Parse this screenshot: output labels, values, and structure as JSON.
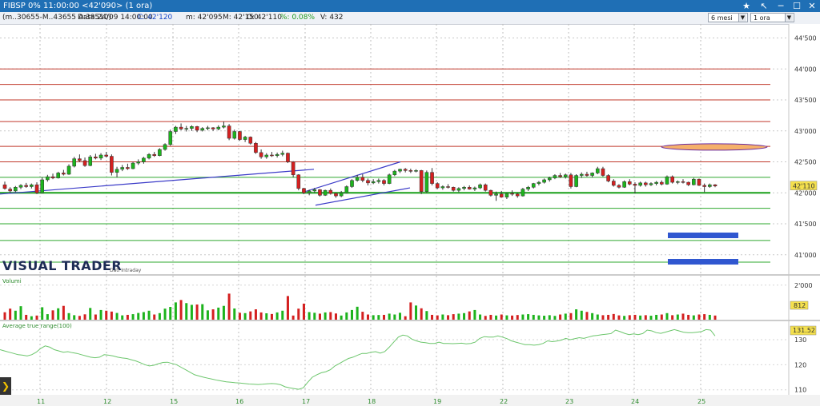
{
  "window": {
    "title": "FIBSP 0% 11:00:00  <42'090>  (1 ora)"
  },
  "infobar": {
    "ref": "(m..30655-M..43655 A:38510)",
    "date": "Data:24/09 14:00:00",
    "close": "C: 42'120",
    "min": "m: 42'095",
    "max": "M: 42'150",
    "open": "O: 42'110",
    "pct": "%: 0.08%",
    "vol": "V: 432",
    "period_select": "6 mesi",
    "interval_select": "1 ora"
  },
  "colors": {
    "up": "#1db31d",
    "down": "#d42020",
    "level_red": "#c0392b",
    "level_green": "#2ea82e",
    "trend": "#3b3bc8",
    "atr": "#6cc66c",
    "marker": "#3057d0",
    "ellipse_fill": "#f5b06a",
    "ellipse_stroke": "#6a2aa0"
  },
  "watermark": {
    "brand": "VISUAL TRADER",
    "sub": "Dati Intraday"
  },
  "chart_data": [
    {
      "type": "candlestick",
      "title": "FIBSP",
      "ylim": [
        40700,
        44700
      ],
      "y_ticks": [
        "44'500",
        "44'000",
        "43'500",
        "43'000",
        "42'500",
        "42'000",
        "41'500",
        "41'000"
      ],
      "y_tick_values": [
        44500,
        44000,
        43500,
        43000,
        42500,
        42000,
        41500,
        41000
      ],
      "x_labels": [
        "11",
        "12",
        "15",
        "16",
        "17",
        "18",
        "19",
        "22",
        "23",
        "24",
        "25"
      ],
      "last_price_label": "42'110",
      "last_price": 42110,
      "red_levels": [
        44000,
        43750,
        43500,
        43150,
        42750,
        42500
      ],
      "green_levels": [
        42250,
        42000,
        41750,
        41500,
        41230,
        40880
      ],
      "candles": [
        [
          42130,
          42180,
          42050,
          42070
        ],
        [
          42060,
          42090,
          42000,
          42030
        ],
        [
          42030,
          42110,
          42010,
          42090
        ],
        [
          42090,
          42140,
          42060,
          42120
        ],
        [
          42120,
          42160,
          42080,
          42100
        ],
        [
          42100,
          42150,
          42070,
          42130
        ],
        [
          42130,
          42170,
          41980,
          42000
        ],
        [
          42000,
          42250,
          41990,
          42210
        ],
        [
          42210,
          42290,
          42180,
          42260
        ],
        [
          42260,
          42310,
          42220,
          42240
        ],
        [
          42240,
          42340,
          42230,
          42320
        ],
        [
          42320,
          42370,
          42280,
          42300
        ],
        [
          42300,
          42460,
          42290,
          42430
        ],
        [
          42430,
          42580,
          42410,
          42550
        ],
        [
          42550,
          42620,
          42500,
          42520
        ],
        [
          42520,
          42570,
          42420,
          42440
        ],
        [
          42440,
          42610,
          42430,
          42580
        ],
        [
          42580,
          42630,
          42540,
          42560
        ],
        [
          42560,
          42640,
          42530,
          42610
        ],
        [
          42610,
          42660,
          42570,
          42590
        ],
        [
          42590,
          42620,
          42280,
          42330
        ],
        [
          42330,
          42420,
          42250,
          42380
        ],
        [
          42380,
          42450,
          42350,
          42410
        ],
        [
          42410,
          42470,
          42370,
          42390
        ],
        [
          42390,
          42500,
          42380,
          42480
        ],
        [
          42480,
          42540,
          42450,
          42500
        ],
        [
          42500,
          42580,
          42470,
          42560
        ],
        [
          42560,
          42640,
          42540,
          42620
        ],
        [
          42620,
          42660,
          42580,
          42600
        ],
        [
          42600,
          42720,
          42590,
          42700
        ],
        [
          42700,
          42800,
          42680,
          42780
        ],
        [
          42780,
          43020,
          42760,
          42990
        ],
        [
          42990,
          43080,
          42950,
          43060
        ],
        [
          43060,
          43120,
          43010,
          43030
        ],
        [
          43030,
          43080,
          42990,
          43040
        ],
        [
          43040,
          43090,
          43000,
          43070
        ],
        [
          43070,
          43080,
          42980,
          43010
        ],
        [
          43010,
          43060,
          42990,
          43040
        ],
        [
          43040,
          43080,
          43010,
          43050
        ],
        [
          43050,
          43060,
          43000,
          43030
        ],
        [
          43030,
          43090,
          43010,
          43060
        ],
        [
          43060,
          43150,
          43040,
          43080
        ],
        [
          43080,
          43110,
          42850,
          42880
        ],
        [
          42880,
          43020,
          42860,
          42990
        ],
        [
          42990,
          43000,
          42840,
          42860
        ],
        [
          42860,
          42920,
          42820,
          42900
        ],
        [
          42900,
          42910,
          42780,
          42800
        ],
        [
          42800,
          42820,
          42630,
          42650
        ],
        [
          42650,
          42700,
          42550,
          42580
        ],
        [
          42580,
          42640,
          42550,
          42610
        ],
        [
          42610,
          42660,
          42580,
          42600
        ],
        [
          42600,
          42650,
          42570,
          42620
        ],
        [
          42620,
          42680,
          42590,
          42640
        ],
        [
          42640,
          42650,
          42480,
          42500
        ],
        [
          42500,
          42510,
          42250,
          42290
        ],
        [
          42290,
          42300,
          42040,
          42070
        ],
        [
          42070,
          42080,
          41980,
          42000
        ],
        [
          42000,
          42050,
          41960,
          42030
        ],
        [
          42030,
          42080,
          42000,
          42050
        ],
        [
          42050,
          42060,
          41940,
          41960
        ],
        [
          41960,
          42050,
          41950,
          42040
        ],
        [
          42040,
          42070,
          41970,
          41990
        ],
        [
          41990,
          42000,
          41920,
          41950
        ],
        [
          41950,
          42030,
          41930,
          42000
        ],
        [
          42000,
          42120,
          41990,
          42100
        ],
        [
          42100,
          42220,
          42080,
          42200
        ],
        [
          42200,
          42290,
          42180,
          42250
        ],
        [
          42250,
          42300,
          42170,
          42200
        ],
        [
          42200,
          42230,
          42120,
          42160
        ],
        [
          42160,
          42220,
          42140,
          42180
        ],
        [
          42180,
          42230,
          42150,
          42200
        ],
        [
          42200,
          42220,
          42120,
          42150
        ],
        [
          42150,
          42310,
          42140,
          42290
        ],
        [
          42290,
          42370,
          42270,
          42350
        ],
        [
          42350,
          42390,
          42320,
          42380
        ],
        [
          42380,
          42400,
          42330,
          42360
        ],
        [
          42360,
          42390,
          42320,
          42350
        ],
        [
          42350,
          42380,
          42330,
          42360
        ],
        [
          42360,
          42370,
          41980,
          42020
        ],
        [
          42020,
          42360,
          42000,
          42330
        ],
        [
          42330,
          42400,
          42120,
          42150
        ],
        [
          42150,
          42170,
          42060,
          42080
        ],
        [
          42080,
          42120,
          42050,
          42100
        ],
        [
          42100,
          42140,
          42070,
          42090
        ],
        [
          42090,
          42100,
          42020,
          42040
        ],
        [
          42040,
          42090,
          42010,
          42070
        ],
        [
          42070,
          42110,
          42040,
          42090
        ],
        [
          42090,
          42120,
          42050,
          42060
        ],
        [
          42060,
          42100,
          42030,
          42080
        ],
        [
          42080,
          42150,
          42060,
          42130
        ],
        [
          42130,
          42150,
          42020,
          42040
        ],
        [
          42040,
          42050,
          41940,
          41960
        ],
        [
          41960,
          42020,
          41870,
          41980
        ],
        [
          41980,
          42030,
          41920,
          41930
        ],
        [
          41930,
          42000,
          41900,
          41990
        ],
        [
          41990,
          42040,
          41950,
          41980
        ],
        [
          41980,
          42000,
          41920,
          41950
        ],
        [
          41950,
          42080,
          41940,
          42060
        ],
        [
          42060,
          42110,
          42030,
          42090
        ],
        [
          42090,
          42160,
          42070,
          42150
        ],
        [
          42150,
          42190,
          42120,
          42170
        ],
        [
          42170,
          42230,
          42150,
          42210
        ],
        [
          42210,
          42260,
          42180,
          42240
        ],
        [
          42240,
          42300,
          42220,
          42280
        ],
        [
          42280,
          42320,
          42240,
          42260
        ],
        [
          42260,
          42310,
          42230,
          42290
        ],
        [
          42290,
          42320,
          42070,
          42100
        ],
        [
          42100,
          42300,
          42090,
          42280
        ],
        [
          42280,
          42330,
          42240,
          42300
        ],
        [
          42300,
          42340,
          42260,
          42280
        ],
        [
          42280,
          42330,
          42250,
          42320
        ],
        [
          42320,
          42420,
          42300,
          42390
        ],
        [
          42390,
          42420,
          42260,
          42280
        ],
        [
          42280,
          42300,
          42170,
          42190
        ],
        [
          42190,
          42220,
          42100,
          42120
        ],
        [
          42120,
          42140,
          42070,
          42090
        ],
        [
          42090,
          42200,
          42080,
          42180
        ],
        [
          42180,
          42220,
          42120,
          42140
        ],
        [
          42140,
          42170,
          41990,
          42120
        ],
        [
          42120,
          42180,
          42100,
          42160
        ],
        [
          42160,
          42180,
          42100,
          42130
        ],
        [
          42130,
          42170,
          42110,
          42150
        ],
        [
          42150,
          42190,
          42120,
          42170
        ],
        [
          42170,
          42200,
          42120,
          42140
        ],
        [
          42140,
          42280,
          42130,
          42260
        ],
        [
          42260,
          42280,
          42150,
          42170
        ],
        [
          42170,
          42200,
          42140,
          42180
        ],
        [
          42180,
          42220,
          42150,
          42170
        ],
        [
          42170,
          42180,
          42110,
          42130
        ],
        [
          42130,
          42240,
          42120,
          42220
        ],
        [
          42220,
          42230,
          42110,
          42120
        ],
        [
          42120,
          42150,
          42010,
          42100
        ],
        [
          42100,
          42150,
          42080,
          42130
        ],
        [
          42130,
          42140,
          42090,
          42110
        ]
      ]
    },
    {
      "type": "bar",
      "title": "Volumi",
      "ylim": [
        0,
        2500
      ],
      "y_ticks": [
        "2'000"
      ],
      "y_tick_values": [
        2000
      ],
      "last_label": "812",
      "values": [
        430,
        640,
        520,
        780,
        280,
        200,
        240,
        720,
        320,
        540,
        660,
        800,
        380,
        260,
        220,
        310,
        680,
        300,
        560,
        520,
        470,
        390,
        250,
        280,
        320,
        390,
        440,
        520,
        300,
        380,
        640,
        740,
        1000,
        1140,
        960,
        860,
        880,
        900,
        540,
        600,
        700,
        800,
        1510,
        650,
        400,
        380,
        480,
        600,
        420,
        370,
        330,
        420,
        520,
        1370,
        240,
        640,
        930,
        440,
        400,
        350,
        420,
        440,
        360,
        240,
        420,
        560,
        750,
        460,
        300,
        260,
        270,
        280,
        350,
        300,
        400,
        200,
        1000,
        820,
        660,
        500,
        280,
        250,
        300,
        260,
        320,
        350,
        380,
        480,
        560,
        300,
        220,
        280,
        240,
        300,
        250,
        240,
        270,
        300,
        320,
        280,
        250,
        230,
        260,
        220,
        300,
        350,
        380,
        600,
        520,
        450,
        380,
        300,
        260,
        280,
        330,
        250,
        220,
        260,
        280,
        240,
        260,
        230,
        280,
        300,
        380,
        260,
        300,
        350,
        280,
        250,
        300,
        320,
        280,
        240
      ],
      "colors_by_candle": true
    },
    {
      "type": "line",
      "title": "Average true range(100)",
      "ylim": [
        108,
        137
      ],
      "y_ticks": [
        "130",
        "120",
        "110"
      ],
      "y_tick_values": [
        130,
        120,
        110
      ],
      "last_label": "131.52",
      "values": [
        126,
        125.5,
        125,
        124.5,
        124,
        123.8,
        123.5,
        124,
        125,
        126.5,
        127.5,
        127,
        126,
        125.5,
        125,
        125.2,
        124.8,
        124.5,
        124,
        123.5,
        123,
        122.8,
        123,
        124,
        123.8,
        123.5,
        123,
        122.7,
        122.5,
        122,
        121.5,
        120.8,
        120,
        119.5,
        119.8,
        120.4,
        120.9,
        121,
        120.5,
        120,
        119,
        118,
        117,
        116,
        115.5,
        115,
        114.6,
        114.2,
        113.8,
        113.5,
        113.2,
        113,
        112.8,
        112.7,
        112.5,
        112.3,
        112.2,
        112.1,
        112.2,
        112.4,
        112.5,
        112.4,
        112,
        111.2,
        110.8,
        110.5,
        110.2,
        110.8,
        113,
        115,
        116,
        116.8,
        117.2,
        118,
        119.5,
        120.5,
        121.5,
        122.5,
        123,
        123.8,
        124.5,
        124.5,
        125,
        125.2,
        124.6,
        125.2,
        127,
        129,
        131,
        131.8,
        131.5,
        130.2,
        129.5,
        129,
        128.8,
        128.5,
        128.5,
        129,
        128.5,
        128.5,
        128.4,
        128.5,
        128.6,
        128.3,
        128.5,
        129,
        130.5,
        131.2,
        131,
        131,
        131.5,
        131,
        130.4,
        129.5,
        129,
        128.5,
        128,
        128,
        127.8,
        128,
        128.5,
        129.5,
        129.2,
        129.4,
        129.8,
        130.5,
        130,
        130.4,
        130.8,
        130.5,
        131,
        131.5,
        131.7,
        132,
        132.2,
        132.4,
        133.8,
        133.2,
        132.5,
        132,
        132.3,
        132,
        132.4,
        133.8,
        133.5,
        132.8,
        132.5,
        133,
        133.5,
        134,
        133.5,
        133,
        132.8,
        132.8,
        133,
        133.2,
        134,
        133.8,
        131.5
      ]
    }
  ]
}
